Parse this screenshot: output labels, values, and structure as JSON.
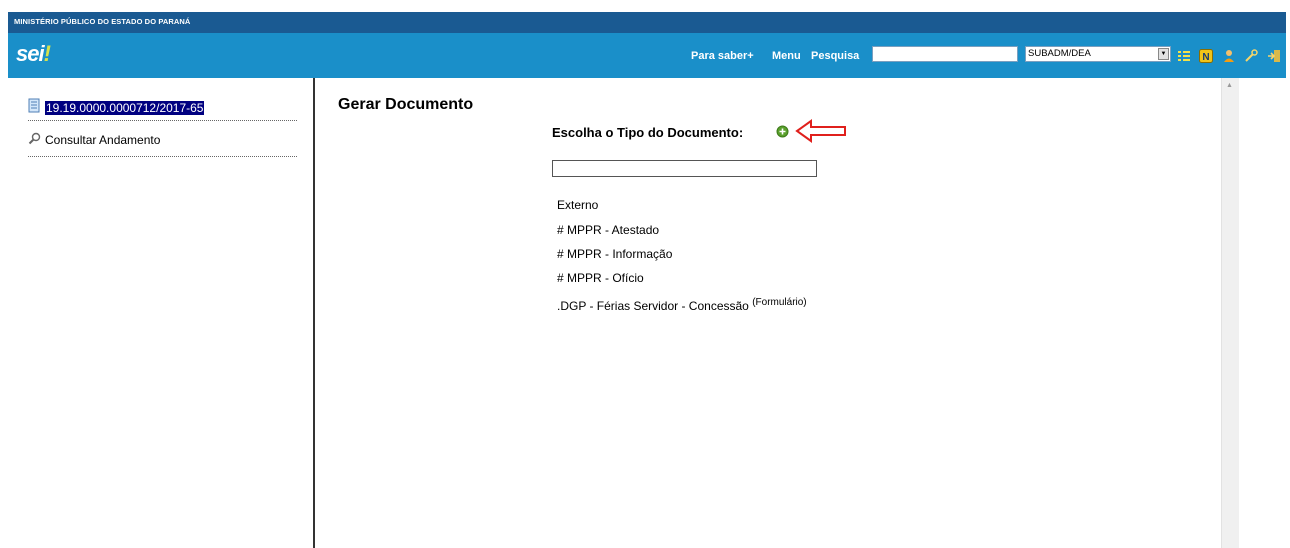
{
  "header": {
    "org_name": "MINISTÉRIO PÚBLICO DO ESTADO DO PARANÁ",
    "logo_text": "sei",
    "logo_accent": "!",
    "links": [
      "Para saber+",
      "Menu",
      "Pesquisa"
    ],
    "search_value": "",
    "unit_selected": "SUBADM/DEA",
    "icons": [
      "list-icon",
      "notice-icon",
      "user-icon",
      "tools-icon",
      "logout-icon"
    ]
  },
  "sidebar": {
    "process_number": "19.19.0000.0000712/2017-65",
    "consult_label": "Consultar Andamento"
  },
  "main": {
    "title": "Gerar Documento",
    "choose_label": "Escolha o Tipo do Documento:",
    "filter_value": "",
    "doc_types": [
      "Externo",
      "# MPPR - Atestado",
      "# MPPR - Informação",
      "# MPPR - Ofício",
      ".DGP - Férias Servidor - Concessão"
    ],
    "form_suffix": "(Formulário)"
  },
  "colors": {
    "header_dark": "#1a5a92",
    "header_main": "#1a8fc9",
    "selection": "#000080",
    "annotation_arrow": "#e0201c",
    "plus_icon": "#5aa02c"
  }
}
